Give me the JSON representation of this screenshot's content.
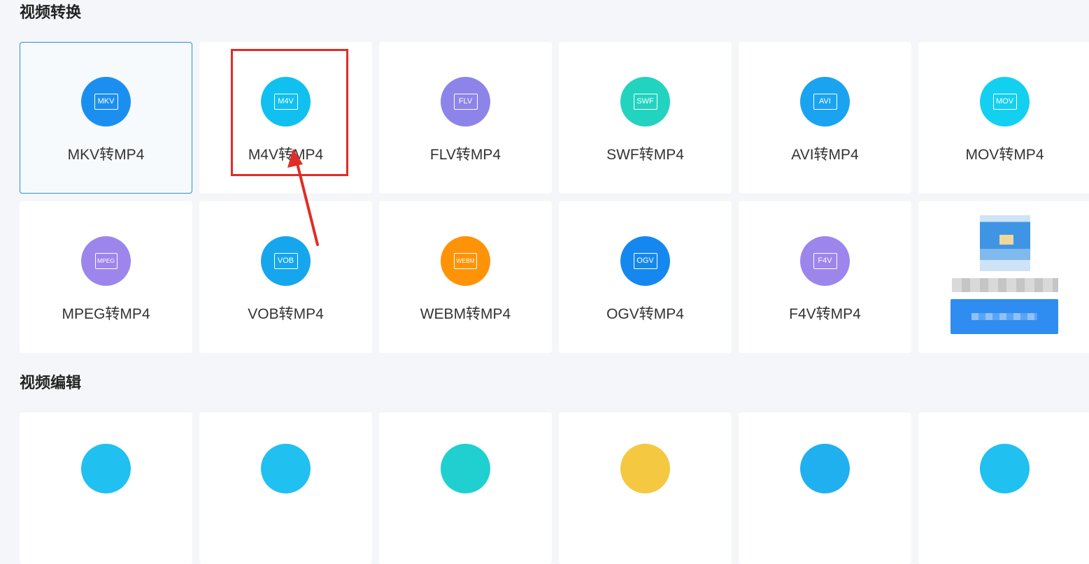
{
  "sections": {
    "convert_title": "视频转换",
    "edit_title": "视频编辑"
  },
  "cards": [
    {
      "icon": "MKV",
      "label": "MKV转MP4",
      "color": "#1b8ff0"
    },
    {
      "icon": "M4V",
      "label": "M4V转MP4",
      "color": "#10c0f0"
    },
    {
      "icon": "FLV",
      "label": "FLV转MP4",
      "color": "#8d84ea"
    },
    {
      "icon": "SWF",
      "label": "SWF转MP4",
      "color": "#22d3c0"
    },
    {
      "icon": "AVI",
      "label": "AVI转MP4",
      "color": "#1aa3f0"
    },
    {
      "icon": "MOV",
      "label": "MOV转MP4",
      "color": "#14d0f0"
    },
    {
      "icon": "MPEG",
      "label": "MPEG转MP4",
      "color": "#9c86ec"
    },
    {
      "icon": "VOB",
      "label": "VOB转MP4",
      "color": "#15a6ee"
    },
    {
      "icon": "WEBM",
      "label": "WEBM转MP4",
      "color": "#ff9308"
    },
    {
      "icon": "OGV",
      "label": "OGV转MP4",
      "color": "#1588ef"
    },
    {
      "icon": "F4V",
      "label": "F4V转MP4",
      "color": "#9c86ec"
    }
  ],
  "edit_card_icon_colors": [
    "#20c0f0",
    "#20c0f0",
    "#20d0d0",
    "#f5c842",
    "#20b0f0",
    "#20c0f0"
  ]
}
